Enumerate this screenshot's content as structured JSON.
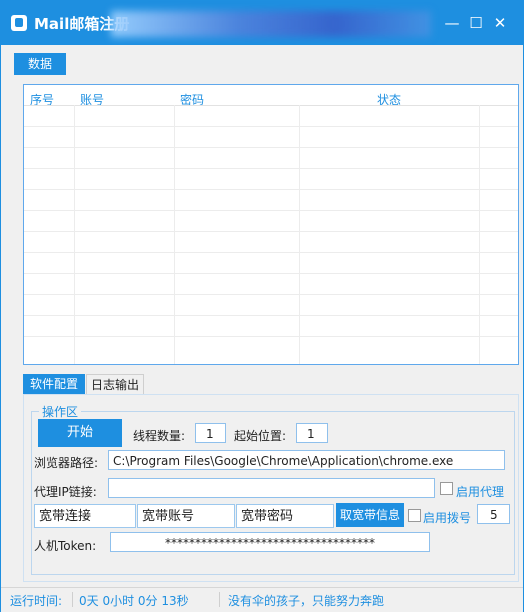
{
  "window": {
    "title": "Mail邮箱注册",
    "minimize_icon": "—",
    "maximize_icon": "☐",
    "close_icon": "✕"
  },
  "tabs_top": [
    {
      "label": "数据"
    }
  ],
  "table": {
    "columns": [
      "序号",
      "账号",
      "密码",
      "状态"
    ],
    "rows": []
  },
  "tabs_bottom": [
    {
      "label": "软件配置"
    },
    {
      "label": "日志输出"
    }
  ],
  "operation": {
    "group_title": "操作区",
    "start_button": "开始",
    "thread_label": "线程数量:",
    "thread_value": "1",
    "start_pos_label": "起始位置:",
    "start_pos_value": "1",
    "browser_label": "浏览器路径:",
    "browser_path": "C:\\Program Files\\Google\\Chrome\\Application\\chrome.exe",
    "proxy_label": "代理IP链接:",
    "proxy_value": "",
    "use_proxy_label": "启用代理",
    "broadband_conn": "宽带连接",
    "broadband_account": "宽带账号",
    "broadband_password": "宽带密码",
    "get_broadband_button": "取宽带信息",
    "use_dial_label": "启用拨号",
    "dial_value": "5",
    "token_label": "人机Token:",
    "token_value": "***********************************"
  },
  "status_bar": {
    "runtime_label": "运行时间:",
    "runtime_value": "0天 0小时 0分 13秒",
    "slogan": "没有伞的孩子，只能努力奔跑"
  }
}
